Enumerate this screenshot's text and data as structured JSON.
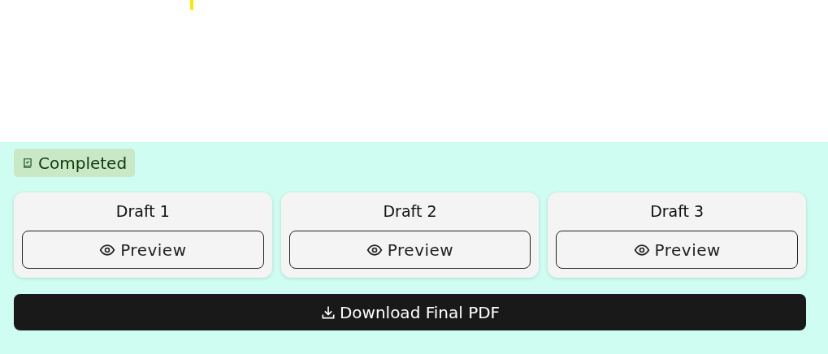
{
  "status_badge": {
    "label": "Completed"
  },
  "drafts": [
    {
      "title": "Draft 1",
      "button": "Preview"
    },
    {
      "title": "Draft 2",
      "button": "Preview"
    },
    {
      "title": "Draft 3",
      "button": "Preview"
    }
  ],
  "download_button": {
    "label": "Download Final PDF"
  }
}
